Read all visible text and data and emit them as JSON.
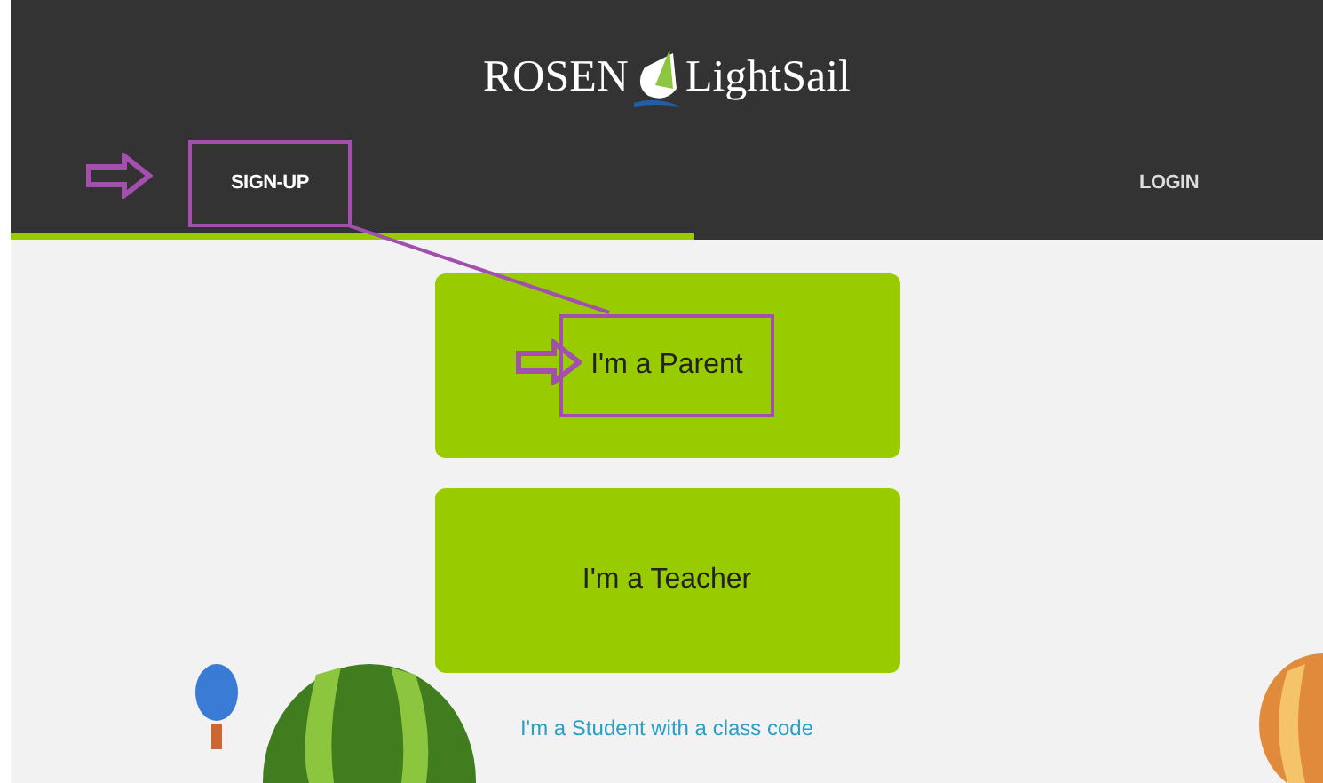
{
  "logo": {
    "left": "ROSEN",
    "right": "LightSail"
  },
  "tabs": [
    {
      "label": "SIGN-UP",
      "selected": true
    },
    {
      "label": "LOGIN",
      "selected": false
    }
  ],
  "role_buttons": [
    {
      "label": "I'm a Parent",
      "highlighted": true
    },
    {
      "label": "I'm a Teacher",
      "highlighted": false
    }
  ],
  "student_link": "I'm a Student with a class code"
}
